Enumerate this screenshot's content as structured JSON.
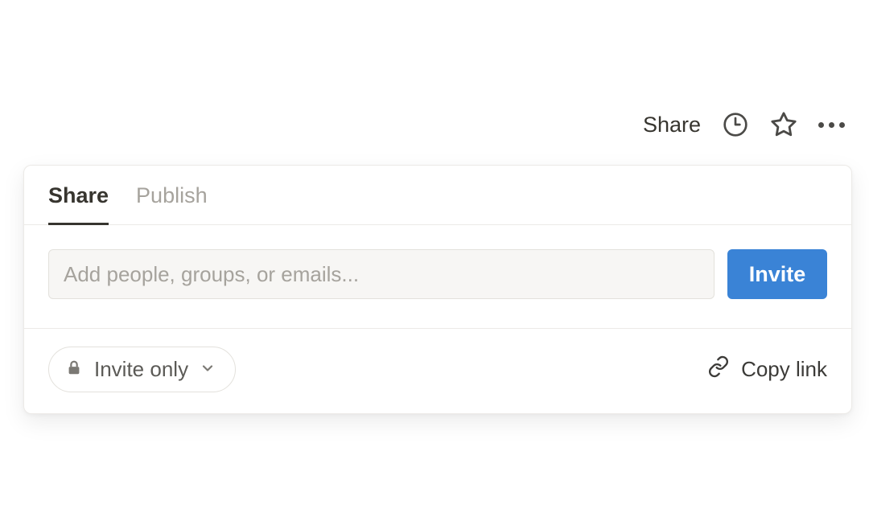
{
  "topbar": {
    "share_label": "Share"
  },
  "panel": {
    "tabs": {
      "share": "Share",
      "publish": "Publish"
    },
    "invite": {
      "placeholder": "Add people, groups, or emails...",
      "button_label": "Invite"
    },
    "access": {
      "label": "Invite only"
    },
    "copy_link_label": "Copy link"
  }
}
